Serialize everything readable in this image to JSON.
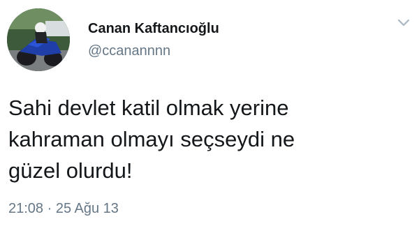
{
  "author": {
    "display_name": "Canan Kaftancıoğlu",
    "handle": "@ccanannnn",
    "avatar_icon": "avatar-image"
  },
  "menu": {
    "icon": "chevron-down-icon",
    "color": "#aab8c2"
  },
  "tweet": {
    "lines": [
      "Sahi devlet katil olmak yerine",
      "kahraman olmayı seçseydi ne",
      "güzel olurdu!"
    ]
  },
  "meta": {
    "timestamp": "21:08 · 25 Ağu 13"
  },
  "colors": {
    "text": "#14171a",
    "secondary": "#657786"
  }
}
